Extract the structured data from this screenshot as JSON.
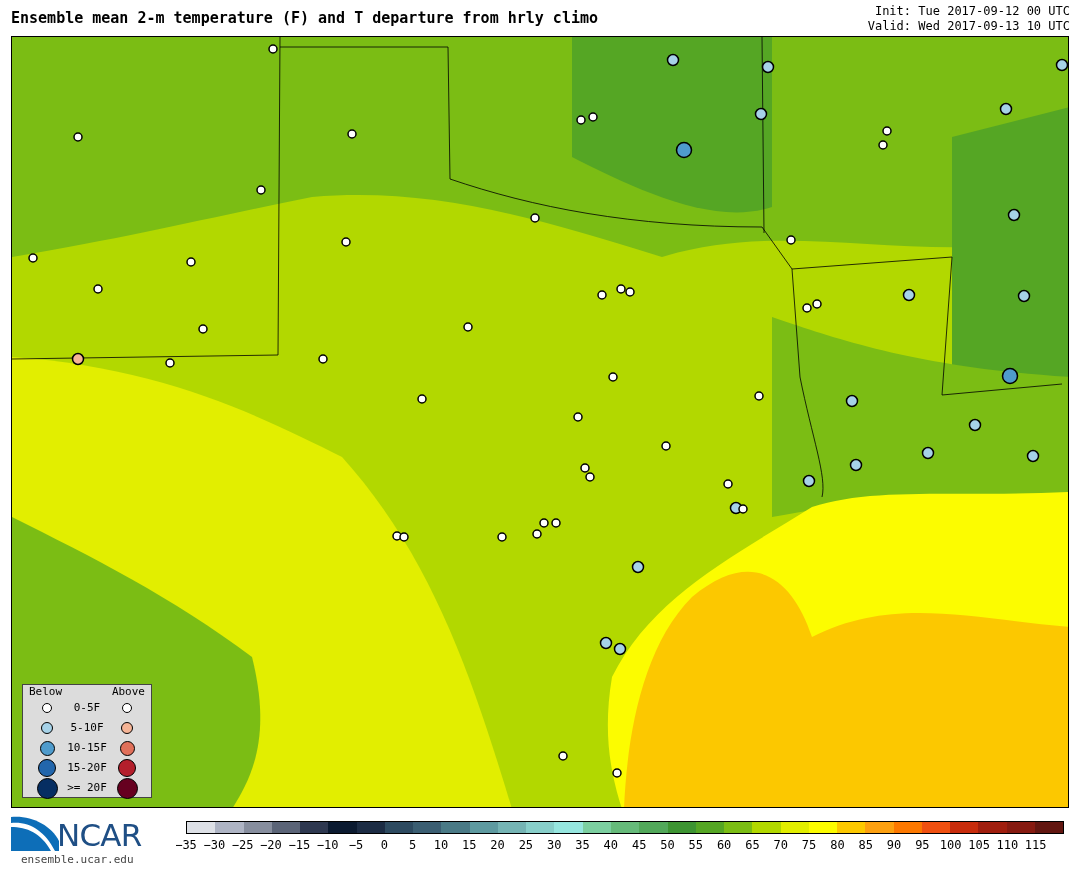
{
  "title": "Ensemble mean 2-m temperature (F) and T departure from hrly climo",
  "init": "Init: Tue 2017-09-12 00 UTC",
  "valid": "Valid: Wed 2017-09-13 10 UTC",
  "legend": {
    "below_heading": "Below",
    "above_heading": "Above",
    "rows": [
      {
        "label": "0-5F",
        "below": {
          "color": "#ffffff"
        },
        "above": {
          "color": "#ffffff"
        }
      },
      {
        "label": "5-10F",
        "below": {
          "color": "#a6d2e8"
        },
        "above": {
          "color": "#f5b496"
        }
      },
      {
        "label": "10-15F",
        "below": {
          "color": "#4f9bcc"
        },
        "above": {
          "color": "#e0705a"
        }
      },
      {
        "label": "15-20F",
        "below": {
          "color": "#2266ac"
        },
        "above": {
          "color": "#b41f2c"
        }
      },
      {
        "label": ">= 20F",
        "below": {
          "color": "#062e62"
        },
        "above": {
          "color": "#660020"
        }
      }
    ]
  },
  "logo": {
    "text": "NCAR",
    "url": "ensemble.ucar.edu"
  },
  "colorbar": {
    "segments": [
      {
        "color": "#dde0e6"
      },
      {
        "color": "#aeb4c4"
      },
      {
        "color": "#878e9e"
      },
      {
        "color": "#5b6477"
      },
      {
        "color": "#2e3850"
      },
      {
        "color": "#0b1a30"
      },
      {
        "color": "#1c2c44"
      },
      {
        "color": "#2d4a60"
      },
      {
        "color": "#3b5e72"
      },
      {
        "color": "#4a7a86"
      },
      {
        "color": "#5e9aa0"
      },
      {
        "color": "#75b4b4"
      },
      {
        "color": "#88cfca"
      },
      {
        "color": "#96e6df"
      },
      {
        "color": "#7ccfa0"
      },
      {
        "color": "#66ba7a"
      },
      {
        "color": "#52a85a"
      },
      {
        "color": "#3d9432"
      },
      {
        "color": "#55a624"
      },
      {
        "color": "#7bbd14"
      },
      {
        "color": "#b2d800"
      },
      {
        "color": "#e2ee00"
      },
      {
        "color": "#fcfc00"
      },
      {
        "color": "#fcc800"
      },
      {
        "color": "#fca010"
      },
      {
        "color": "#fc7800"
      },
      {
        "color": "#f05010"
      },
      {
        "color": "#c82c0c"
      },
      {
        "color": "#a01e0e"
      },
      {
        "color": "#861a10"
      },
      {
        "color": "#621610"
      }
    ],
    "labels": [
      "−35",
      "−30",
      "−25",
      "−20",
      "−15",
      "−10",
      "−5",
      "0",
      "5",
      "10",
      "15",
      "20",
      "25",
      "30",
      "35",
      "40",
      "45",
      "50",
      "55",
      "60",
      "65",
      "70",
      "75",
      "80",
      "85",
      "90",
      "95",
      "100",
      "105",
      "110",
      "115"
    ]
  }
}
